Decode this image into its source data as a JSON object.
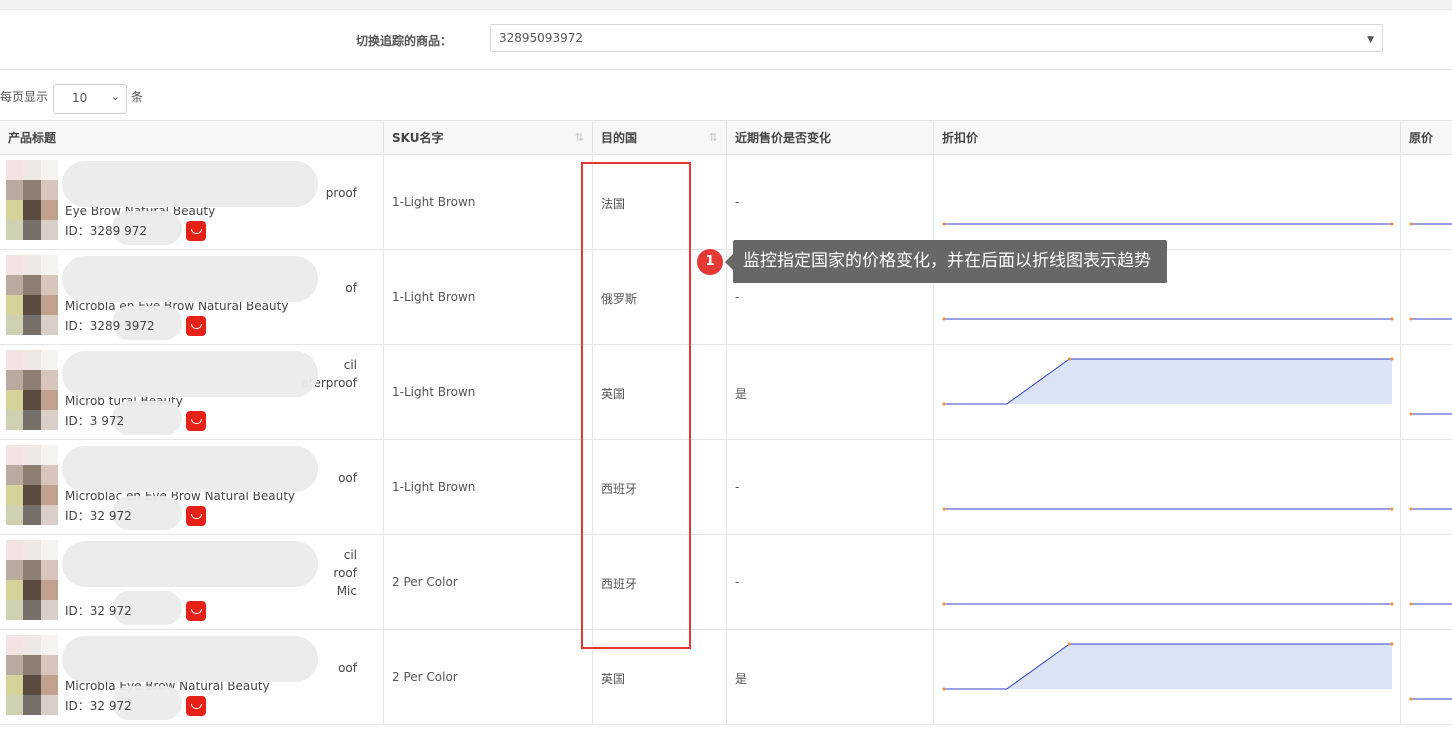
{
  "switcher": {
    "label": "切换追踪的商品：",
    "selected": "32895093972"
  },
  "pagination": {
    "prefix": "每页显示",
    "size": "10",
    "suffix": "条"
  },
  "columns": [
    "产品标题",
    "SKU名字",
    "目的国",
    "近期售价是否变化",
    "折扣价",
    "原价"
  ],
  "rows": [
    {
      "title_lines": [
        "",
        "",
        "proof",
        "Eye Brow Natural Beauty"
      ],
      "id": "ID：3289   972",
      "sku": "1-Light Brown",
      "country": "法国",
      "changed": "-",
      "trend": [
        1,
        1
      ]
    },
    {
      "title_lines": [
        "",
        "",
        "of",
        "Microbla     en Eye Brow Natural Beauty"
      ],
      "id": "ID：3289    3972",
      "sku": "1-Light Brown",
      "country": "俄罗斯",
      "changed": "-",
      "trend": [
        1,
        1
      ]
    },
    {
      "title_lines": [
        "cil",
        "aterproof",
        "Microb      tural Beauty"
      ],
      "id": "ID：3       972",
      "sku": "1-Light Brown",
      "country": "英国",
      "changed": "是",
      "trend": [
        0,
        0,
        1,
        1
      ]
    },
    {
      "title_lines": [
        "",
        "",
        "oof",
        "Microblac      en Eye Brow Natural Beauty"
      ],
      "id": "ID：32       972",
      "sku": "1-Light Brown",
      "country": "西班牙",
      "changed": "-",
      "trend": [
        1,
        1
      ]
    },
    {
      "title_lines": [
        "cil",
        "roof",
        "Mic"
      ],
      "id": "ID：32       972",
      "sku": "2 Per Color",
      "country": "西班牙",
      "changed": "-",
      "trend": [
        1,
        1
      ]
    },
    {
      "title_lines": [
        "",
        "oof",
        "Microbla      Eye Brow Natural Beauty"
      ],
      "id": "ID：32       972",
      "sku": "2 Per Color",
      "country": "英国",
      "changed": "是",
      "trend": [
        0,
        0,
        1,
        1
      ]
    }
  ],
  "annotation": {
    "number": "1",
    "text": "监控指定国家的价格变化，并在后面以折线图表示趋势"
  },
  "colors": {
    "line": "#3340c8",
    "fill": "#dbe4f7",
    "marker": "#f08c3a",
    "highlight": "#e53935",
    "store": "#e62117"
  }
}
